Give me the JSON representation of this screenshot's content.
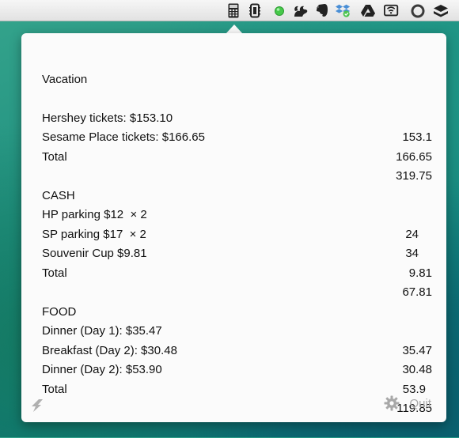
{
  "menubar": {
    "icons": [
      "calculator-icon",
      "memory-clean-icon",
      "green-status-dot-icon",
      "squirrel-icon",
      "evernote-icon",
      "dropbox-icon",
      "google-drive-icon",
      "wifi-card-icon",
      "circle-icon",
      "stack-icon"
    ]
  },
  "sheet": {
    "title": "Vacation",
    "sections": [
      {
        "heading": "",
        "rows": [
          {
            "expr": "Hershey tickets: $153.10",
            "result": "153.1"
          },
          {
            "expr": "Sesame Place tickets: $166.65",
            "result": "166.65"
          },
          {
            "expr": "Total",
            "result": "319.75"
          }
        ]
      },
      {
        "heading": "CASH",
        "rows": [
          {
            "expr": "HP parking $12  × 2",
            "result": "24"
          },
          {
            "expr": "SP parking $17  × 2",
            "result": "34"
          },
          {
            "expr": "Souvenir Cup $9.81",
            "result": "9.81"
          },
          {
            "expr": "Total",
            "result": "67.81"
          }
        ]
      },
      {
        "heading": "FOOD",
        "rows": [
          {
            "expr": "Dinner (Day 1): $35.47",
            "result": "35.47"
          },
          {
            "expr": "Breakfast (Day 2): $30.48",
            "result": "30.48"
          },
          {
            "expr": "Dinner (Day 2): $53.90",
            "result": "53.9"
          },
          {
            "expr": "Total",
            "result": "119.85"
          }
        ]
      }
    ]
  },
  "footer": {
    "quit_label": "Quit",
    "left_icon": "bolt-icon",
    "settings_icon": "gear-icon"
  },
  "colors": {
    "popover_bg": "#fbfbfb",
    "text": "#111111",
    "footer_text": "#a8a8a8",
    "status_green": "#46c94a"
  }
}
